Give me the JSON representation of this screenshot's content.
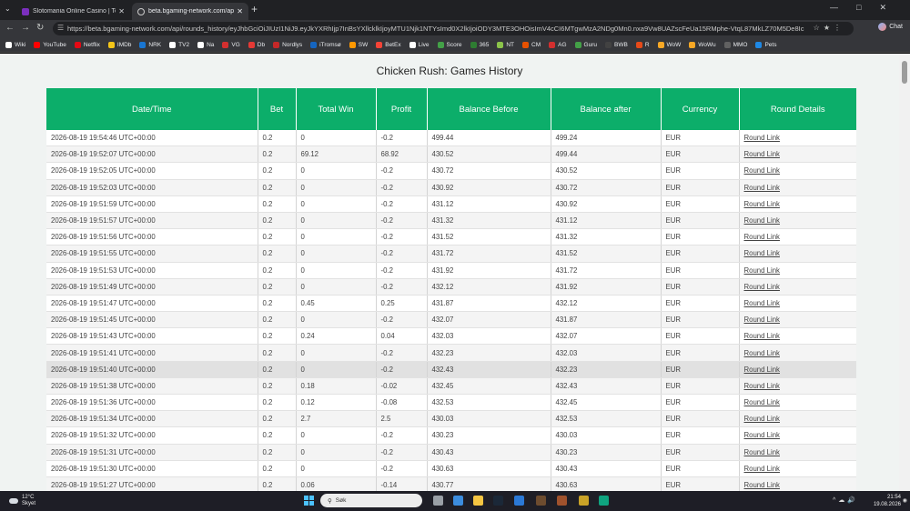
{
  "browser": {
    "tabs": [
      {
        "title": "Slotomania Online Casino | Top Slo",
        "active": false
      },
      {
        "title": "beta.bgaming-network.com/api/ro",
        "active": true
      }
    ],
    "url": "https://beta.bgaming-network.com/api/rounds_history/eyJhbGciOiJIUzI1NiJ9.eyJkYXRhIjp7InBsYXllcklkIjoyMTU1Njk1NTYsImd0X2lkIjoiODY3MTE3OHOisImV4cCI6MTgwMzA2NDg0Mn0.nxa9Vw8UAZscFeUa15RMphe-VtqL87MkLZ70M5De8Ic",
    "chat_label": "Chat",
    "bookmarks": [
      {
        "label": "Wiki",
        "color": "#ffffff"
      },
      {
        "label": "YouTube",
        "color": "#ff0000"
      },
      {
        "label": "Netflix",
        "color": "#e50914"
      },
      {
        "label": "IMDb",
        "color": "#f5c518"
      },
      {
        "label": "NRK",
        "color": "#1976d2"
      },
      {
        "label": "TV2",
        "color": "#ffffff"
      },
      {
        "label": "Na",
        "color": "#ffffff"
      },
      {
        "label": "VG",
        "color": "#d32f2f"
      },
      {
        "label": "Db",
        "color": "#e53935"
      },
      {
        "label": "Nordlys",
        "color": "#c62828"
      },
      {
        "label": "iTromsø",
        "color": "#1565c0"
      },
      {
        "label": "SW",
        "color": "#ff9800"
      },
      {
        "label": "BetEx",
        "color": "#f44336"
      },
      {
        "label": "Live",
        "color": "#ffffff"
      },
      {
        "label": "Score",
        "color": "#43a047"
      },
      {
        "label": "365",
        "color": "#2e7d32"
      },
      {
        "label": "NT",
        "color": "#8bc34a"
      },
      {
        "label": "CM",
        "color": "#e65100"
      },
      {
        "label": "AG",
        "color": "#d32f2f"
      },
      {
        "label": "Guru",
        "color": "#43a047"
      },
      {
        "label": "BWB",
        "color": "#424242"
      },
      {
        "label": "R",
        "color": "#e64a19"
      },
      {
        "label": "WoW",
        "color": "#f9a825"
      },
      {
        "label": "WoWu",
        "color": "#f9a825"
      },
      {
        "label": "MMO",
        "color": "#616161"
      },
      {
        "label": "Pets",
        "color": "#1e88e5"
      }
    ]
  },
  "page": {
    "title": "Chicken Rush: Games History",
    "columns": [
      "Date/Time",
      "Bet",
      "Total Win",
      "Profit",
      "Balance Before",
      "Balance after",
      "Currency",
      "Round Details"
    ],
    "rows": [
      [
        "2026-08-19 19:54:46 UTC+00:00",
        "0.2",
        "0",
        "-0.2",
        "499.44",
        "499.24",
        "EUR",
        "Round Link"
      ],
      [
        "2026-08-19 19:52:07 UTC+00:00",
        "0.2",
        "69.12",
        "68.92",
        "430.52",
        "499.44",
        "EUR",
        "Round Link"
      ],
      [
        "2026-08-19 19:52:05 UTC+00:00",
        "0.2",
        "0",
        "-0.2",
        "430.72",
        "430.52",
        "EUR",
        "Round Link"
      ],
      [
        "2026-08-19 19:52:03 UTC+00:00",
        "0.2",
        "0",
        "-0.2",
        "430.92",
        "430.72",
        "EUR",
        "Round Link"
      ],
      [
        "2026-08-19 19:51:59 UTC+00:00",
        "0.2",
        "0",
        "-0.2",
        "431.12",
        "430.92",
        "EUR",
        "Round Link"
      ],
      [
        "2026-08-19 19:51:57 UTC+00:00",
        "0.2",
        "0",
        "-0.2",
        "431.32",
        "431.12",
        "EUR",
        "Round Link"
      ],
      [
        "2026-08-19 19:51:56 UTC+00:00",
        "0.2",
        "0",
        "-0.2",
        "431.52",
        "431.32",
        "EUR",
        "Round Link"
      ],
      [
        "2026-08-19 19:51:55 UTC+00:00",
        "0.2",
        "0",
        "-0.2",
        "431.72",
        "431.52",
        "EUR",
        "Round Link"
      ],
      [
        "2026-08-19 19:51:53 UTC+00:00",
        "0.2",
        "0",
        "-0.2",
        "431.92",
        "431.72",
        "EUR",
        "Round Link"
      ],
      [
        "2026-08-19 19:51:49 UTC+00:00",
        "0.2",
        "0",
        "-0.2",
        "432.12",
        "431.92",
        "EUR",
        "Round Link"
      ],
      [
        "2026-08-19 19:51:47 UTC+00:00",
        "0.2",
        "0.45",
        "0.25",
        "431.87",
        "432.12",
        "EUR",
        "Round Link"
      ],
      [
        "2026-08-19 19:51:45 UTC+00:00",
        "0.2",
        "0",
        "-0.2",
        "432.07",
        "431.87",
        "EUR",
        "Round Link"
      ],
      [
        "2026-08-19 19:51:43 UTC+00:00",
        "0.2",
        "0.24",
        "0.04",
        "432.03",
        "432.07",
        "EUR",
        "Round Link"
      ],
      [
        "2026-08-19 19:51:41 UTC+00:00",
        "0.2",
        "0",
        "-0.2",
        "432.23",
        "432.03",
        "EUR",
        "Round Link"
      ],
      [
        "2026-08-19 19:51:40 UTC+00:00",
        "0.2",
        "0",
        "-0.2",
        "432.43",
        "432.23",
        "EUR",
        "Round Link"
      ],
      [
        "2026-08-19 19:51:38 UTC+00:00",
        "0.2",
        "0.18",
        "-0.02",
        "432.45",
        "432.43",
        "EUR",
        "Round Link"
      ],
      [
        "2026-08-19 19:51:36 UTC+00:00",
        "0.2",
        "0.12",
        "-0.08",
        "432.53",
        "432.45",
        "EUR",
        "Round Link"
      ],
      [
        "2026-08-19 19:51:34 UTC+00:00",
        "0.2",
        "2.7",
        "2.5",
        "430.03",
        "432.53",
        "EUR",
        "Round Link"
      ],
      [
        "2026-08-19 19:51:32 UTC+00:00",
        "0.2",
        "0",
        "-0.2",
        "430.23",
        "430.03",
        "EUR",
        "Round Link"
      ],
      [
        "2026-08-19 19:51:31 UTC+00:00",
        "0.2",
        "0",
        "-0.2",
        "430.43",
        "430.23",
        "EUR",
        "Round Link"
      ],
      [
        "2026-08-19 19:51:30 UTC+00:00",
        "0.2",
        "0",
        "-0.2",
        "430.63",
        "430.43",
        "EUR",
        "Round Link"
      ],
      [
        "2026-08-19 19:51:27 UTC+00:00",
        "0.2",
        "0.06",
        "-0.14",
        "430.77",
        "430.63",
        "EUR",
        "Round Link"
      ]
    ],
    "highlighted_row": 14,
    "header_color": "#0cae6a"
  },
  "taskbar": {
    "weather_temp": "12°C",
    "weather_desc": "Skyet",
    "search_placeholder": "Søk",
    "time": "21:54",
    "date": "19.08.2026",
    "icons": [
      {
        "name": "task-view-icon",
        "color": "#9aa0a6"
      },
      {
        "name": "widgets-icon",
        "color": "#3c8dde"
      },
      {
        "name": "file-explorer-icon",
        "color": "#f4c542"
      },
      {
        "name": "steam-icon",
        "color": "#1b2838"
      },
      {
        "name": "mail-icon",
        "color": "#2b79d6"
      },
      {
        "name": "game-icon",
        "color": "#6d4c2f"
      },
      {
        "name": "wow-icon",
        "color": "#a0522d"
      },
      {
        "name": "wow-launcher-icon",
        "color": "#c9a227"
      },
      {
        "name": "edge-icon",
        "color": "#0fa37f"
      }
    ]
  }
}
